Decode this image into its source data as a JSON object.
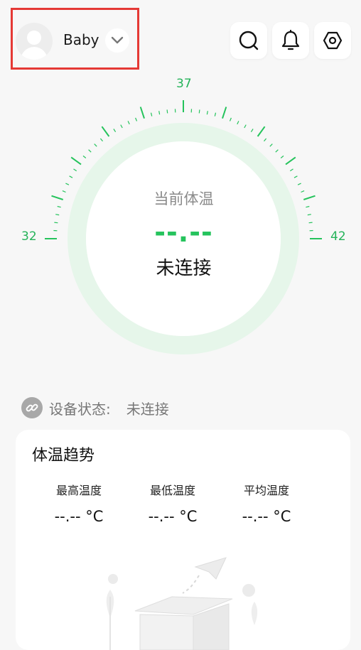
{
  "header": {
    "profile_name": "Baby",
    "icons": [
      "avatar",
      "chevron-down-icon",
      "search-icon",
      "bell-icon",
      "settings-icon"
    ]
  },
  "gauge": {
    "min_label": "32",
    "mid_label": "37",
    "max_label": "42",
    "title": "当前体温",
    "value": "--.--",
    "status": "未连接",
    "accent_color": "#25c35c",
    "ring_color": "#e6f6ea"
  },
  "device": {
    "label": "设备状态:",
    "value": "未连接"
  },
  "trend": {
    "title": "体温趋势",
    "stats": [
      {
        "label": "最高温度",
        "value": "--.-- °C"
      },
      {
        "label": "最低温度",
        "value": "--.-- °C"
      },
      {
        "label": "平均温度",
        "value": "--.-- °C"
      }
    ]
  }
}
